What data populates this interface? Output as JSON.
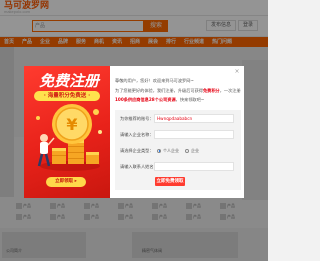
{
  "header": {
    "logo": "马可波罗网",
    "logo_sub": "makepolo.com",
    "search_category": "产品",
    "search_button": "搜索",
    "publish_button": "发布信息",
    "login_button": "登录"
  },
  "nav": {
    "items": [
      "首页",
      "产品",
      "企业",
      "品牌",
      "服务",
      "商机",
      "资讯",
      "招商",
      "展会",
      "排行",
      "行业频道",
      "热门问题"
    ]
  },
  "background": {
    "rows": [
      [
        "产品",
        "产品",
        "产品",
        "产品",
        "产品",
        "产品",
        "产品"
      ],
      [
        "产品",
        "产品",
        "产品",
        "产品",
        "产品",
        "产品",
        "产品"
      ]
    ],
    "bottom_left": "公司简介",
    "bottom_right": "精密气体阀"
  },
  "promo": {
    "title": "免费注册",
    "ribbon": "· 海量积分免费送 ·",
    "cta": "立即领取 ▸"
  },
  "dialog": {
    "close": "×",
    "greeting": "尊敬的用户，您好！欢迎来到马可波罗网~",
    "line2_prefix": "为了您能更好的体验，我们注册，升级后可获得",
    "line2_highlight": "免费积分",
    "line2_suffix": "，一次注册",
    "line3_highlight": "100条供应商信息28个公司资源",
    "line3_suffix": "，快来领取吧~",
    "form": {
      "account_label": "为你推荐的账号：",
      "account_value": "Hwnqpdaababcn",
      "company_label": "请输入企业名称：",
      "company_placeholder": "",
      "type_label": "请选择企业类型：",
      "radio_personal": "个人企业",
      "radio_company": "企业",
      "contact_label": "请输入联系人姓名：",
      "contact_placeholder": "",
      "submit": "立即免费领取"
    }
  }
}
